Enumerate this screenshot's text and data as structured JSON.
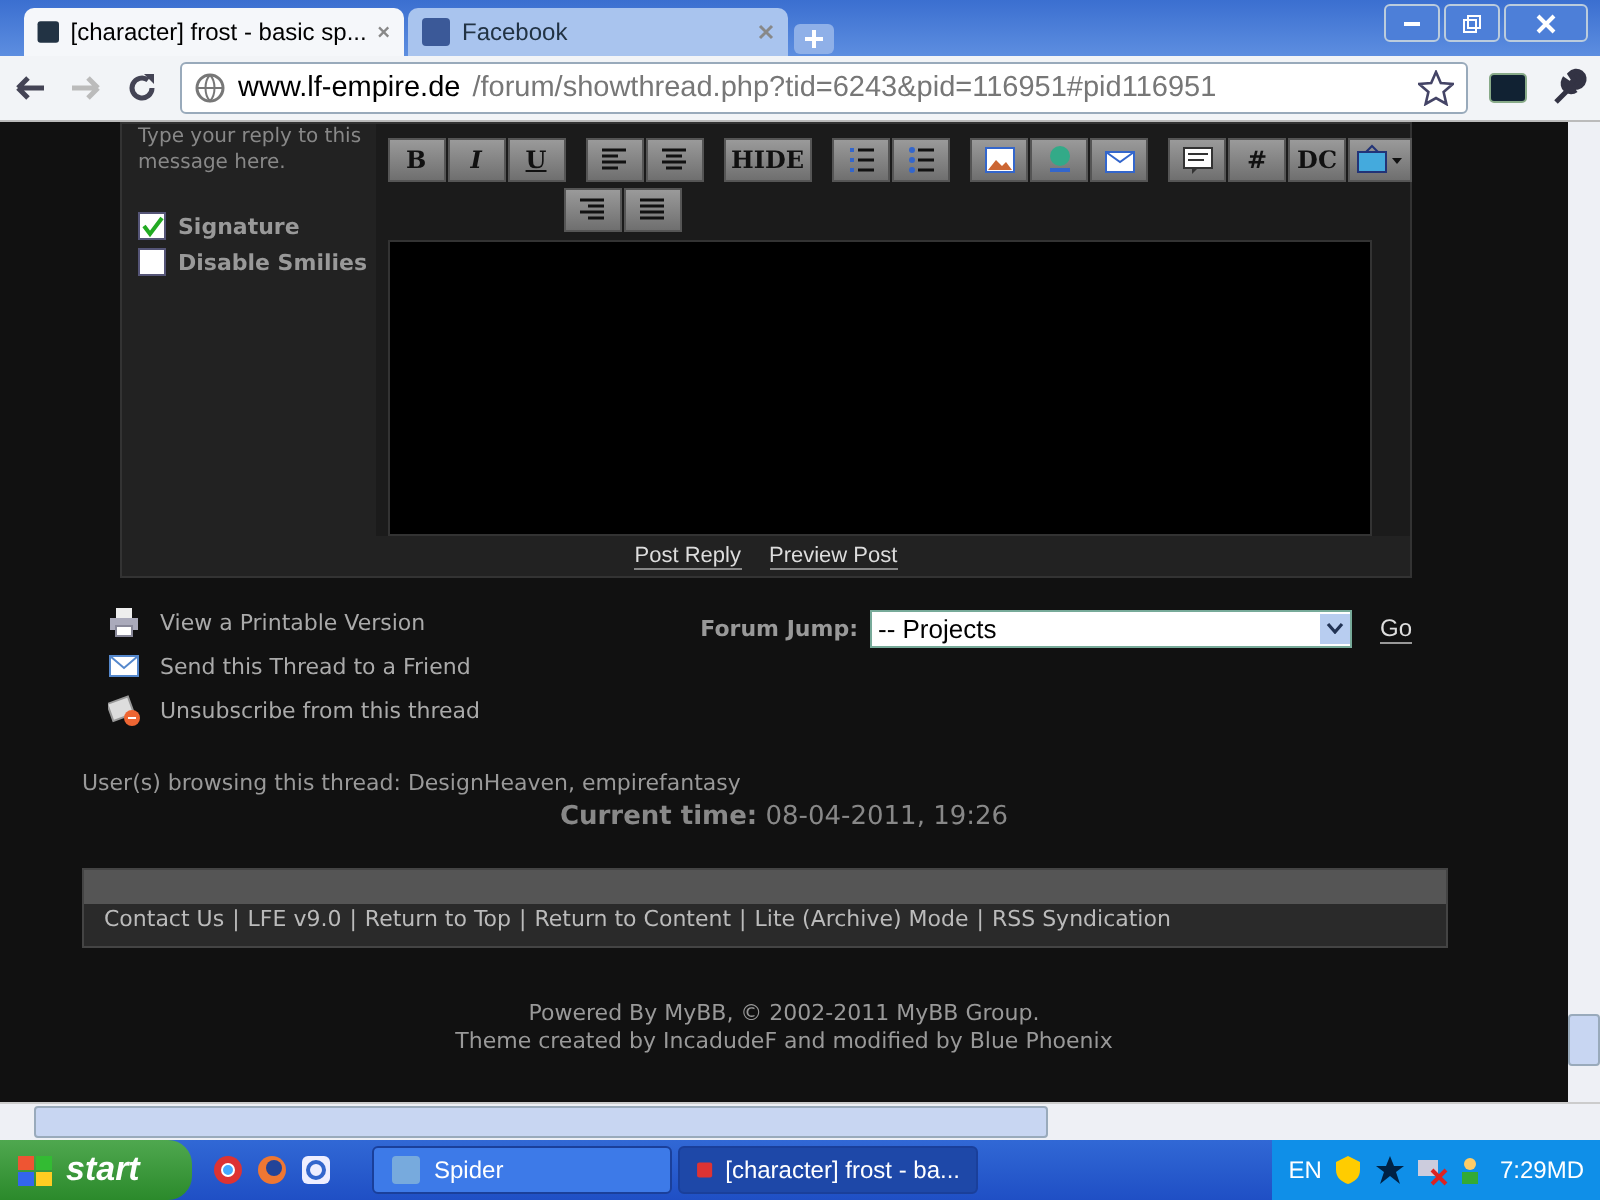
{
  "browser": {
    "tabs": [
      {
        "title": "[character] frost - basic sp...",
        "selected": true
      },
      {
        "title": "Facebook",
        "selected": false
      }
    ],
    "address": {
      "host": "www.lf-empire.de",
      "path": "/forum/showthread.php?tid=6243&pid=116951#pid116951"
    }
  },
  "reply_form": {
    "hint": [
      "Type your reply to this",
      "message here."
    ],
    "options": [
      {
        "label": "Signature",
        "checked": true
      },
      {
        "label": "Disable Smilies",
        "checked": false
      }
    ],
    "toolbar": [
      [
        {
          "kind": "text",
          "label": "B"
        },
        {
          "kind": "text",
          "label": "I"
        },
        {
          "kind": "text",
          "label": "U"
        }
      ],
      [
        {
          "kind": "align-left"
        },
        {
          "kind": "align-center"
        }
      ],
      [
        {
          "kind": "text",
          "label": "HIDE"
        }
      ],
      [
        {
          "kind": "ordered-list"
        },
        {
          "kind": "bullet-list"
        }
      ],
      [
        {
          "kind": "image"
        },
        {
          "kind": "link"
        },
        {
          "kind": "email"
        }
      ],
      [
        {
          "kind": "quote"
        },
        {
          "kind": "text",
          "label": "#"
        },
        {
          "kind": "text",
          "label": "DC"
        },
        {
          "kind": "video"
        }
      ]
    ],
    "toolbar_row2": [
      {
        "kind": "align-right"
      },
      {
        "kind": "justify"
      }
    ],
    "buttons": [
      "Post Reply",
      "Preview Post"
    ]
  },
  "thread_tools": [
    {
      "kind": "print",
      "label": "View a Printable Version"
    },
    {
      "kind": "mail",
      "label": "Send this Thread to a Friend"
    },
    {
      "kind": "unsubscribe",
      "label": "Unsubscribe from this thread"
    }
  ],
  "forum_jump": {
    "label": "Forum Jump:",
    "value": "-- Projects",
    "button": "Go"
  },
  "browsing": "User(s) browsing this thread: DesignHeaven, empirefantasy",
  "current_time": {
    "label": "Current time:",
    "value": "08-04-2011, 19:26"
  },
  "footer_separator": "|",
  "footer_links": [
    "Contact Us",
    "LFE v9.0",
    "Return to Top",
    "Return to Content",
    "Lite (Archive) Mode",
    "RSS Syndication"
  ],
  "credits": [
    "Powered By MyBB, © 2002-2011 MyBB Group.",
    "Theme created by IncadudeF and modified by Blue Phoenix"
  ],
  "taskbar": {
    "start": "start",
    "tasks": [
      {
        "title": "Spider",
        "selected": false
      },
      {
        "title": "[character] frost - ba...",
        "selected": true
      }
    ],
    "language": "EN",
    "clock": "7:29MD"
  }
}
